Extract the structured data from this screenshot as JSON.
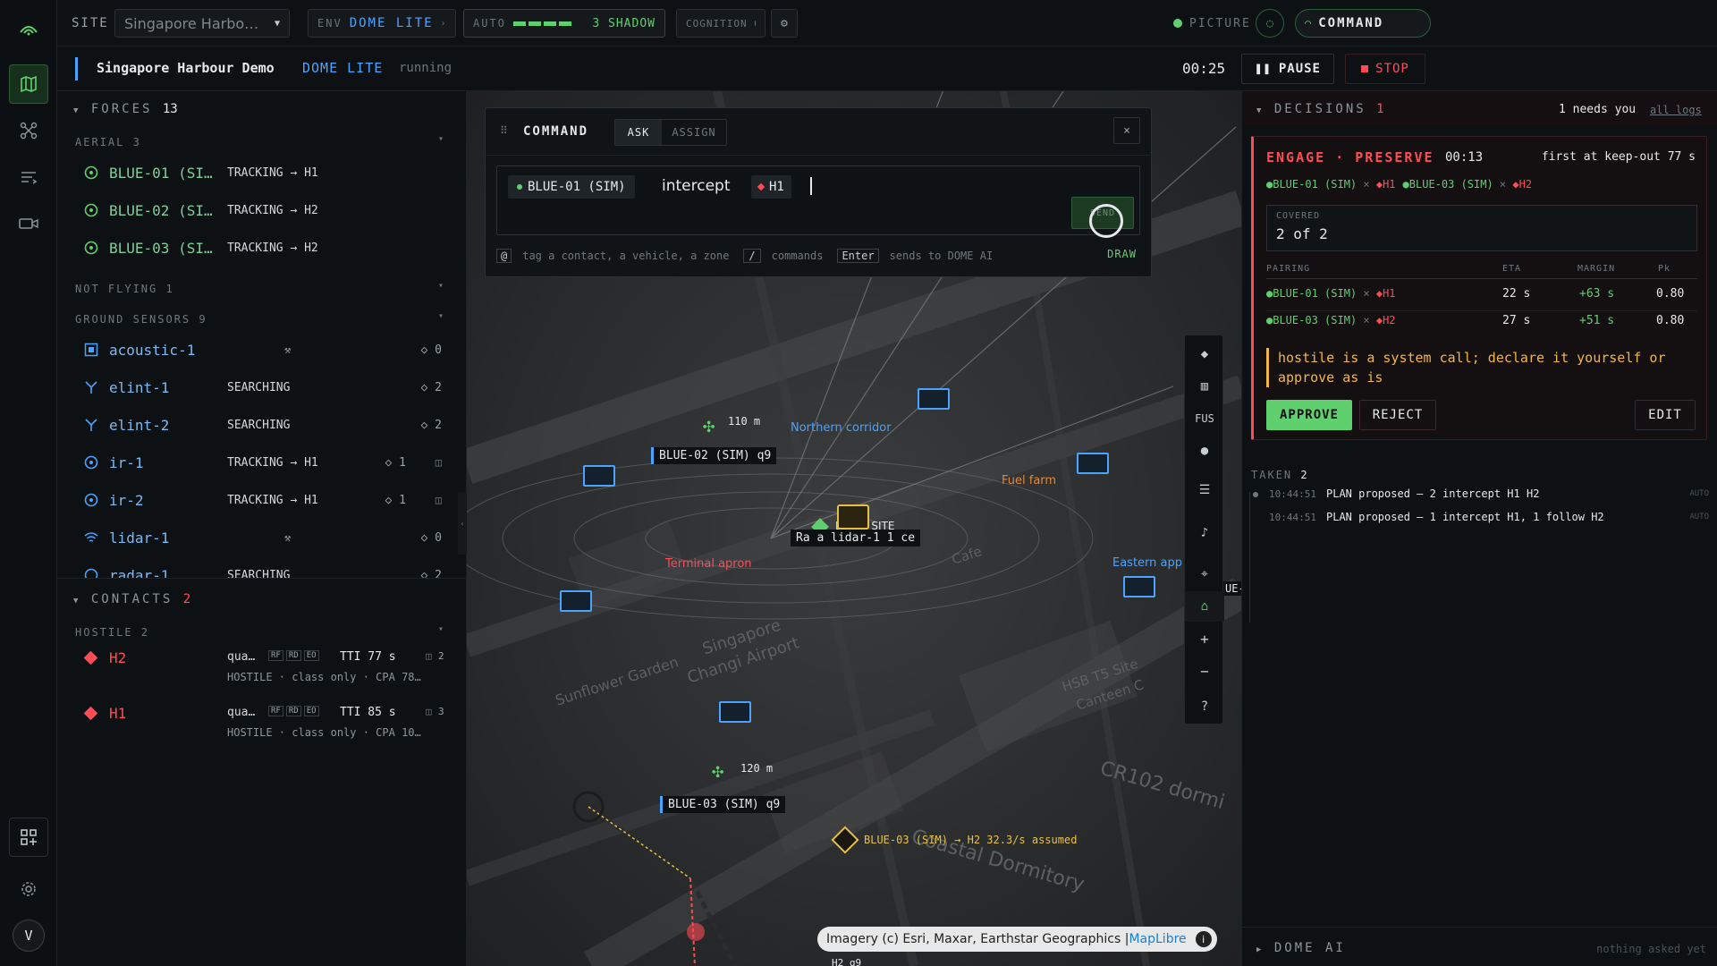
{
  "topbar": {
    "site_label": "SITE",
    "site_value": "Singapore Harbo…",
    "env_label": "ENV",
    "env_value": "DOME LITE",
    "auto_label": "AUTO",
    "auto_value": "3 SHADOW",
    "cognition_label": "COGNITION",
    "picture_label": "PICTURE",
    "command_label": "COMMAND"
  },
  "subbar": {
    "title": "Singapore Harbour Demo",
    "env": "DOME LITE",
    "state": "running",
    "clock": "00:25",
    "pause": "PAUSE",
    "stop": "STOP"
  },
  "forces": {
    "title": "FORCES",
    "count": "13",
    "aerial_label": "AERIAL 3",
    "aerial": [
      {
        "name": "BLUE-01 (SI…",
        "status": "TRACKING → H1"
      },
      {
        "name": "BLUE-02 (SI…",
        "status": "TRACKING → H2"
      },
      {
        "name": "BLUE-03 (SI…",
        "status": "TRACKING → H2"
      }
    ],
    "not_flying_label": "NOT FLYING 1",
    "ground_label": "GROUND SENSORS 9",
    "ground": [
      {
        "name": "acoustic-1",
        "status": "",
        "count": "◇ 0"
      },
      {
        "name": "elint-1",
        "status": "SEARCHING",
        "count": "◇ 2"
      },
      {
        "name": "elint-2",
        "status": "SEARCHING",
        "count": "◇ 2"
      },
      {
        "name": "ir-1",
        "status": "TRACKING → H1",
        "count": "◇ 1"
      },
      {
        "name": "ir-2",
        "status": "TRACKING → H1",
        "count": "◇ 1"
      },
      {
        "name": "lidar-1",
        "status": "",
        "count": "◇ 0"
      },
      {
        "name": "radar-1",
        "status": "SEARCHING",
        "count": "◇ 2"
      }
    ]
  },
  "contacts": {
    "title": "CONTACTS",
    "count": "2",
    "hostile_label": "HOSTILE 2",
    "items": [
      {
        "id": "H2",
        "cls": "qua…",
        "tags": [
          "RF",
          "RD",
          "EO"
        ],
        "tti": "TTI 77 s",
        "cams": "2",
        "detail": "HOSTILE · class only · CPA 78…"
      },
      {
        "id": "H1",
        "cls": "qua…",
        "tags": [
          "RF",
          "RD",
          "EO"
        ],
        "tti": "TTI 85 s",
        "cams": "3",
        "detail": "HOSTILE · class only · CPA 10…"
      }
    ]
  },
  "command": {
    "title": "COMMAND",
    "tab_ask": "ASK",
    "tab_assign": "ASSIGN",
    "chip_unit": "BLUE-01 (SIM)",
    "verb": "intercept",
    "chip_target": "H1",
    "send": "SEND",
    "hint_at": "@",
    "hint_at_text": "tag a contact, a vehicle, a zone",
    "hint_slash": "/",
    "hint_slash_text": "commands",
    "hint_enter": "Enter",
    "hint_enter_text": "sends to DOME AI",
    "draw": "DRAW"
  },
  "map": {
    "labels": {
      "northern": "Northern corridor",
      "fuel": "Fuel farm",
      "terminal": "Terminal apron",
      "eastern": "Eastern app",
      "dome_site": "DOME SITE",
      "airport1": "Singapore",
      "airport2": "Changi Airport",
      "sunflower": "Sunflower Garden",
      "dorm": "Coastal Dormitory",
      "cr102": "CR102 dormi",
      "hsb": "HSB T5 Site",
      "canteen": "Canteen C",
      "cafe": "Cafe"
    },
    "alt1": "110 m",
    "alt2": "120 m",
    "blue02": "BLUE-02 (SIM) q9",
    "blue03": "BLUE-03 (SIM) q9",
    "center_tag": "Ra a lidar-1 1 ce",
    "assumed": "BLUE-03 (SIM) → H2 32.3/s assumed",
    "edge_tag": "UE-",
    "h2_tag": "H2 q9",
    "attribution": "Imagery (c) Esri, Maxar, Earthstar Geographics | ",
    "attribution_link": "MapLibre",
    "tools": [
      "◆",
      "▥",
      "FUS",
      "●",
      "☰",
      "♪",
      "⌖",
      "⌂",
      "+",
      "−",
      "?"
    ]
  },
  "decisions": {
    "title": "DECISIONS",
    "count": "1",
    "needs": "1 needs you",
    "all_logs": "all logs",
    "card": {
      "headline": "ENGAGE · PRESERVE",
      "timer": "00:13",
      "first": "first at keep-out 77 s",
      "pair1_unit": "BLUE-01 (SIM)",
      "pair1_target": "H1",
      "pair2_unit": "BLUE-03 (SIM)",
      "pair2_target": "H2",
      "covered_label": "COVERED",
      "covered_value": "2 of 2",
      "cols": [
        "PAIRING",
        "ETA",
        "MARGIN",
        "Pk"
      ],
      "rows": [
        {
          "unit": "BLUE-01 (SIM)",
          "target": "H1",
          "eta": "22 s",
          "margin": "+63 s",
          "pk": "0.80"
        },
        {
          "unit": "BLUE-03 (SIM)",
          "target": "H2",
          "eta": "27 s",
          "margin": "+51 s",
          "pk": "0.80"
        }
      ],
      "warning": "hostile is a system call; declare it yourself or approve as is",
      "approve": "APPROVE",
      "reject": "REJECT",
      "edit": "EDIT"
    },
    "taken_label": "TAKEN",
    "taken_count": "2",
    "taken": [
      {
        "time": "10:44:51",
        "text": "PLAN proposed — 2 intercept H1 H2",
        "mode": "AUTO"
      },
      {
        "time": "10:44:51",
        "text": "PLAN proposed — 1 intercept H1, 1 follow H2",
        "mode": "AUTO"
      }
    ]
  },
  "dome_ai": {
    "title": "DOME AI",
    "status": "nothing asked yet"
  },
  "user_initial": "V",
  "colors": {
    "accent_green": "#5fd06d",
    "friendly_blue": "#4aa3ff",
    "hostile_red": "#ff4b55",
    "warning_amber": "#f2b640"
  }
}
